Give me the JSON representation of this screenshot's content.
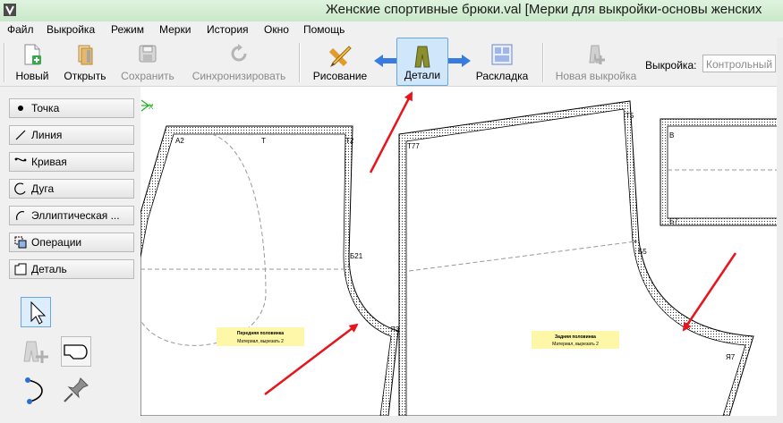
{
  "window": {
    "title": "Женские спортивные брюки.val [Мерки для выкройки-основы женских"
  },
  "menu": [
    "Файл",
    "Выкройка",
    "Режим",
    "Мерки",
    "История",
    "Окно",
    "Помощь"
  ],
  "toolbar": {
    "new_label": "Новый",
    "open_label": "Открыть",
    "save_label": "Сохранить",
    "sync_label": "Синхронизировать",
    "draw_label": "Рисование",
    "details_label": "Детали",
    "layout_label": "Раскладка",
    "new_pattern_label": "Новая выкройка",
    "pattern_label": "Выкройка:",
    "pattern_value": "Контрольный"
  },
  "tools": [
    "Точка",
    "Линия",
    "Кривая",
    "Дуга",
    "Эллиптическая ...",
    "Операции",
    "Деталь"
  ],
  "canvas": {
    "origin_label": "X",
    "points": {
      "a2": "A2",
      "t": "T",
      "t2": "T2",
      "b21": "Б21",
      "ya3": "Я3",
      "t77": "T77",
      "t5": "T5",
      "b5": "Б5",
      "ya7": "Я7",
      "b": "В",
      "b7": "Б7"
    },
    "front": {
      "name": "Передняя половинка",
      "material": "Материал, вырезать 2"
    },
    "back": {
      "name": "Задняя половинка",
      "material": "Материал, вырезать 2"
    }
  },
  "colors": {
    "accent": "#e8141b",
    "selected": "#cfe6fb",
    "title_bg": "#c9e8c9",
    "label_bg": "#fff7a8"
  }
}
